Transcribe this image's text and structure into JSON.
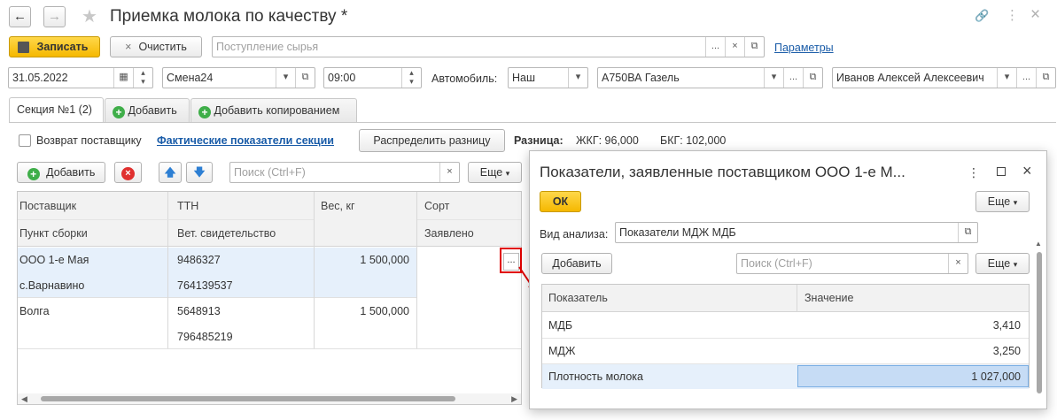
{
  "window": {
    "title": "Приемка молока по качеству *",
    "nav_back": "←",
    "nav_forward": "→",
    "star": "★",
    "link_icon": "🔗",
    "more_icon": "⋮",
    "close_icon": "×"
  },
  "toolbar": {
    "save_label": "Записать",
    "clear_label": "Очистить",
    "clear_icon": "×",
    "source_placeholder": "Поступление сырья",
    "params_link": "Параметры"
  },
  "header_fields": {
    "date": "31.05.2022",
    "shift": "Смена24",
    "time": "09:00",
    "car_label": "Автомобиль:",
    "car_owner": "Наш",
    "car": "А750ВА Газель",
    "driver": "Иванов Алексей Алексеевич"
  },
  "tabs": [
    {
      "label": "Секция №1 (2)"
    },
    {
      "label": "Добавить"
    },
    {
      "label": "Добавить копированием"
    }
  ],
  "section": {
    "return_label": "Возврат поставщику",
    "actual_link": "Фактические показатели секции",
    "distribute_label": "Распределить разницу",
    "diff_label": "Разница:",
    "diff_zhkg": "ЖКГ: 96,000",
    "diff_bkg": "БКГ: 102,000"
  },
  "table_toolbar": {
    "add_label": "Добавить",
    "search_placeholder": "Поиск (Ctrl+F)",
    "more_label": "Еще"
  },
  "table": {
    "headers_row1": [
      "Поставщик",
      "ТТН",
      "Вес, кг",
      "Сорт"
    ],
    "headers_row2": [
      "Пункт сборки",
      "Вет. свидетельство",
      "",
      "Заявлено"
    ],
    "rows": [
      {
        "supplier": "ООО 1-е Мая",
        "point": "с.Варнавино",
        "ttn": "9486327",
        "vet": "764139537",
        "weight": "1 500,000",
        "ellipsis": "..."
      },
      {
        "supplier": "Волга",
        "point": "",
        "ttn": "5648913",
        "vet": "796485219",
        "weight": "1 500,000"
      }
    ]
  },
  "dialog": {
    "title": "Показатели, заявленные поставщиком ООО 1-е М...",
    "ok_label": "ОК",
    "more_label": "Еще",
    "analysis_label": "Вид анализа:",
    "analysis_value": "Показатели МДЖ МДБ",
    "add_label": "Добавить",
    "search_placeholder": "Поиск (Ctrl+F)",
    "col_indicator": "Показатель",
    "col_value": "Значение",
    "rows": [
      {
        "name": "МДБ",
        "value": "3,410"
      },
      {
        "name": "МДЖ",
        "value": "3,250"
      },
      {
        "name": "Плотность молока",
        "value": "1 027,000"
      }
    ]
  },
  "colors": {
    "accent_yellow": "#f5b800",
    "link_blue": "#1a5ca8",
    "highlight_red": "#e00000",
    "selected_row": "#e6f0fb",
    "selected_cell": "#c6dcf5"
  }
}
